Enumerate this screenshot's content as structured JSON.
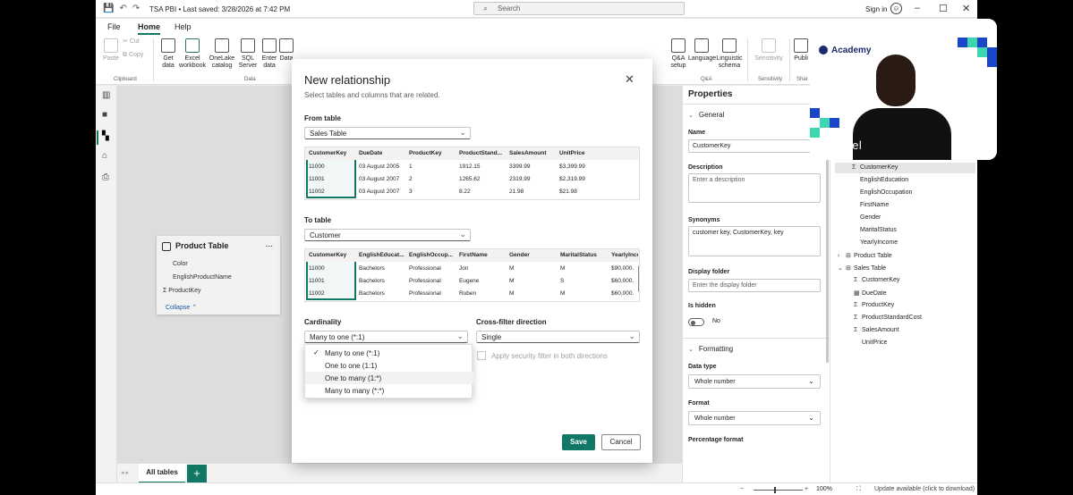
{
  "titlebar": {
    "title": "TSA PBI • Last saved: 3/28/2026 at 7:42 PM",
    "search_placeholder": "Search",
    "signin": "Sign in"
  },
  "menu": [
    "File",
    "Home",
    "Help"
  ],
  "ribbon": {
    "clipboard": {
      "paste": "Paste",
      "cut": "Cut",
      "copy": "Copy",
      "group": "Clipboard"
    },
    "data": {
      "get_data": "Get data",
      "excel": "Excel workbook",
      "onelake": "OneLake catalog",
      "sql": "SQL Server",
      "enter": "Enter data",
      "dataverse": "Data",
      "group": "Data"
    },
    "qa": {
      "qa_setup": "Q&A setup",
      "language": "Language",
      "linguistic": "Linguistic schema",
      "group": "Q&A"
    },
    "sensitivity": {
      "label": "Sensitivity",
      "group": "Sensitivity"
    },
    "share": {
      "publish": "Publi",
      "group": "Shar"
    }
  },
  "canvas": {
    "card": {
      "title": "Product Table",
      "more": "...",
      "fields": [
        "Color",
        "EnglishProductName",
        "ProductKey"
      ],
      "collapse": "Collapse"
    }
  },
  "tabs": {
    "all_tables": "All tables",
    "add": "+"
  },
  "status": {
    "zoom_pct": "100%",
    "update": "Update available (click to download)"
  },
  "dialog": {
    "title": "New relationship",
    "subtitle": "Select tables and columns that are related.",
    "from_label": "From table",
    "from_value": "Sales Table",
    "from_headers": [
      "CustomerKey",
      "DueDate",
      "ProductKey",
      "ProductStand...",
      "SalesAmount",
      "UnitPrice"
    ],
    "from_rows": [
      [
        "11000",
        "03 August 2005",
        "1",
        "1912.15",
        "3399.99",
        "$3,399.99"
      ],
      [
        "11001",
        "03 August 2007",
        "2",
        "1265.62",
        "2319.99",
        "$2,319.99"
      ],
      [
        "11002",
        "03 August 2007",
        "3",
        "8.22",
        "21.98",
        "$21.98"
      ]
    ],
    "to_label": "To table",
    "to_value": "Customer",
    "to_headers": [
      "CustomerKey",
      "EnglishEducat...",
      "EnglishOccup...",
      "FirstName",
      "Gender",
      "MaritalStatus",
      "YearlyInco"
    ],
    "to_rows": [
      [
        "11000",
        "Bachelors",
        "Professional",
        "Jon",
        "M",
        "M",
        "$90,000."
      ],
      [
        "11001",
        "Bachelors",
        "Professional",
        "Eugene",
        "M",
        "S",
        "$60,000."
      ],
      [
        "11002",
        "Bachelors",
        "Professional",
        "Ruben",
        "M",
        "M",
        "$60,000."
      ]
    ],
    "cardinality_label": "Cardinality",
    "cardinality_value": "Many to one (*:1)",
    "crossfilter_label": "Cross-filter direction",
    "crossfilter_value": "Single",
    "security_label": "Apply security filter in both directions",
    "save": "Save",
    "cancel": "Cancel",
    "close": "✕",
    "options": [
      "Many to one (*:1)",
      "One to one (1:1)",
      "One to many (1:*)",
      "Many to many (*:*)"
    ],
    "selected_option": 0
  },
  "properties": {
    "title": "Properties",
    "general": "General",
    "name_label": "Name",
    "name_value": "CustomerKey",
    "description_label": "Description",
    "description_placeholder": "Enter a description",
    "synonyms_label": "Synonyms",
    "synonyms_value": "customer key, CustomerKey, key",
    "display_folder_label": "Display folder",
    "display_folder_placeholder": "Enter the display folder",
    "hidden_label": "Is hidden",
    "hidden_value": "No",
    "formatting": "Formatting",
    "datatype_label": "Data type",
    "datatype_value": "Whole number",
    "format_label": "Format",
    "format_value": "Whole number",
    "percentage_label": "Percentage format"
  },
  "data_pane": {
    "customer_fields": [
      "CustomerKey",
      "EnglishEducation",
      "EnglishOccupation",
      "FirstName",
      "Gender",
      "MaritalStatus",
      "YearlyIncome"
    ],
    "product_table": "Product Table",
    "sales_table": "Sales Table",
    "sales_fields": [
      "CustomerKey",
      "DueDate",
      "ProductKey",
      "ProductStandardCost",
      "SalesAmount",
      "UnitPrice"
    ]
  },
  "camera": {
    "brand": "Academy",
    "name": "Ezekiel"
  },
  "colors": {
    "accent": "#117865",
    "brand": "#1a2a6b",
    "cam_teal": "#3dd6b0",
    "cam_blue": "#1a47c9"
  }
}
